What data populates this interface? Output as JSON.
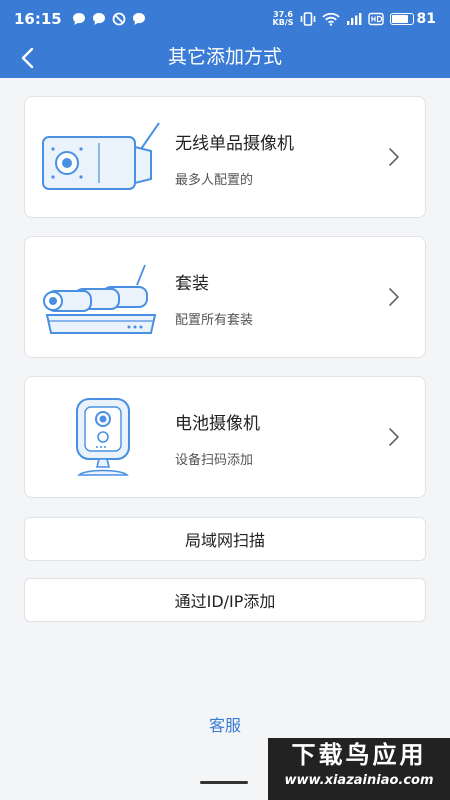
{
  "status_bar": {
    "time": "16:15",
    "net_speed_value": "37.6",
    "net_speed_unit": "KB/S",
    "battery_level": "81",
    "icons": [
      "chat-bubble-icon",
      "chat-bubble-icon",
      "do-not-disturb-icon",
      "chat-bubble-icon",
      "vibrate-icon",
      "wifi-icon",
      "signal-icon",
      "hd-icon",
      "battery-icon"
    ]
  },
  "header": {
    "title": "其它添加方式",
    "back_icon": "chevron-left-icon"
  },
  "options": [
    {
      "title": "无线单品摄像机",
      "subtitle": "最多人配置的",
      "icon": "wireless-camera-illustration"
    },
    {
      "title": "套装",
      "subtitle": "配置所有套装",
      "icon": "camera-kit-nvr-illustration"
    },
    {
      "title": "电池摄像机",
      "subtitle": "设备扫码添加",
      "icon": "battery-camera-illustration"
    }
  ],
  "buttons": {
    "lan_scan": "局域网扫描",
    "add_by_id_ip": "通过ID/IP添加"
  },
  "footer": {
    "service_link": "客服"
  },
  "watermark": {
    "main": "下载鸟应用",
    "url": "www.xiazainiao.com"
  },
  "colors": {
    "primary": "#3a7bd5",
    "background": "#f4f5f7",
    "illustration_stroke": "#4a90e2",
    "illustration_fill": "#eaf2fc"
  }
}
